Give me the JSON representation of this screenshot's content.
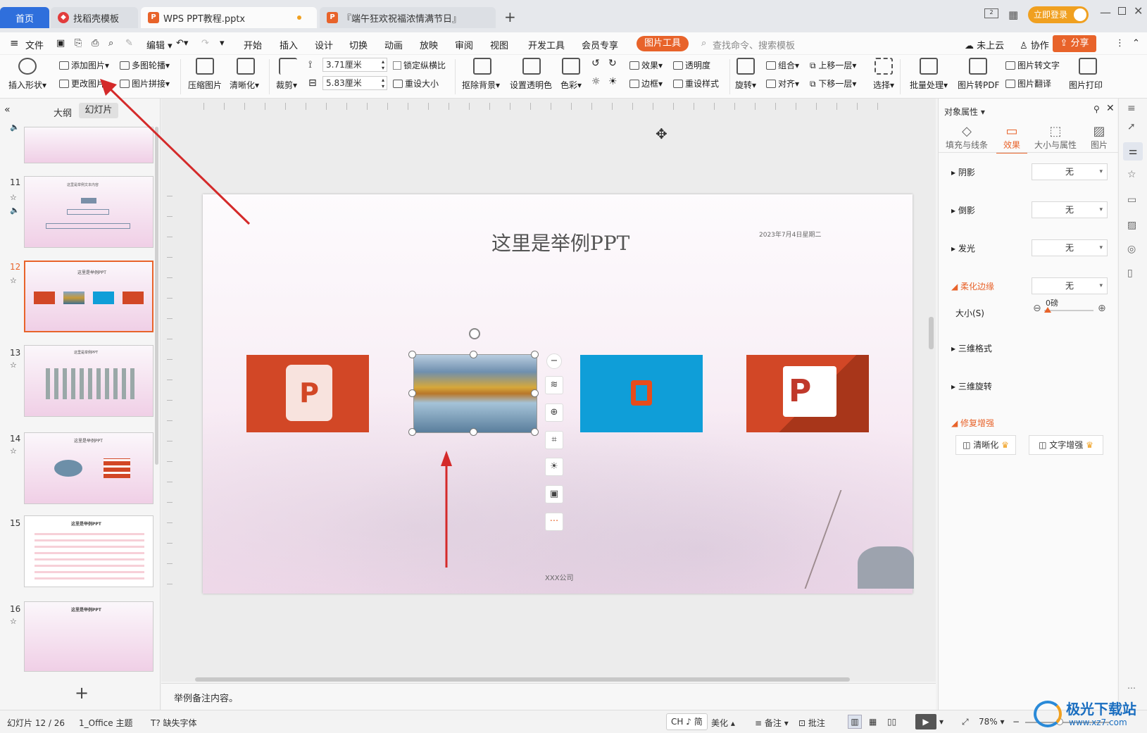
{
  "tabs": {
    "home": "首页",
    "t1": "找稻壳模板",
    "t2": "WPS PPT教程.pptx",
    "t3": "『端午狂欢祝福浓情满节日』",
    "new": "+"
  },
  "titlebar": {
    "login": "立即登录"
  },
  "menu": {
    "file": "文件",
    "edit": "编辑",
    "items": [
      "开始",
      "插入",
      "设计",
      "切换",
      "动画",
      "放映",
      "审阅",
      "视图",
      "开发工具",
      "会员专享"
    ],
    "active": "图片工具",
    "search": "查找命令、搜索模板",
    "cloud": "未上云",
    "collab": "协作",
    "share": "分享"
  },
  "ribbon": {
    "insert_shape": "插入形状",
    "add_pic": "添加图片",
    "change_pic": "更改图片",
    "multi_outline": "多图轮播",
    "pic_join": "图片拼接",
    "compress": "压缩图片",
    "sharpen": "清晰化",
    "crop": "裁剪",
    "width": "3.71厘米",
    "height": "5.83厘米",
    "lock_ratio": "锁定纵横比",
    "resize": "重设大小",
    "remove_bg": "抠除背景",
    "set_transparent": "设置透明色",
    "color": "色彩",
    "effect": "效果",
    "transparency": "透明度",
    "border": "边框",
    "reset_style": "重设样式",
    "rotate": "旋转",
    "group": "组合",
    "align": "对齐",
    "up": "上移一层",
    "down": "下移一层",
    "select": "选择",
    "batch": "批量处理",
    "to_pdf": "图片转PDF",
    "to_text": "图片转文字",
    "translate": "图片翻译",
    "print": "图片打印"
  },
  "left": {
    "outline": "大纲",
    "slides": "幻灯片",
    "nums": [
      "11",
      "12",
      "13",
      "14",
      "15",
      "16"
    ],
    "t11": "这里是举例文本内容",
    "t12": "这里是举例PPT",
    "t13": "这里是举例PPT",
    "t14": "这里是举例PPT",
    "t15": "这里是举例PPT",
    "t16": "这里是举例PPT",
    "add": "+"
  },
  "slide": {
    "title": "这里是举例PPT",
    "date": "2023年7月4日星期二",
    "company": "XXX公司"
  },
  "notes": "举例备注内容。",
  "right": {
    "header": "对象属性",
    "tabs": [
      "填充与线条",
      "效果",
      "大小与属性",
      "图片"
    ],
    "shadow": "阴影",
    "reflection": "倒影",
    "glow": "发光",
    "soft": "柔化边缘",
    "size": "大小(S)",
    "size_val": "0磅",
    "none": "无",
    "three_d_format": "三维格式",
    "three_d_rotate": "三维旋转",
    "repair": "修复增强",
    "sharpen": "清晰化",
    "text_enhance": "文字增强"
  },
  "status": {
    "slide": "幻灯片 12 / 26",
    "theme": "1_Office 主题",
    "font": "缺失字体",
    "ime": "CH ♪ 简",
    "beautify": "美化",
    "notes": "备注",
    "comment": "批注",
    "zoom": "78%"
  },
  "watermark": {
    "name": "极光下载站",
    "url": "www.xz7.com"
  },
  "colors": {
    "accent": "#e8632a",
    "office_red": "#d24726",
    "office_blue": "#0f9ed8"
  }
}
